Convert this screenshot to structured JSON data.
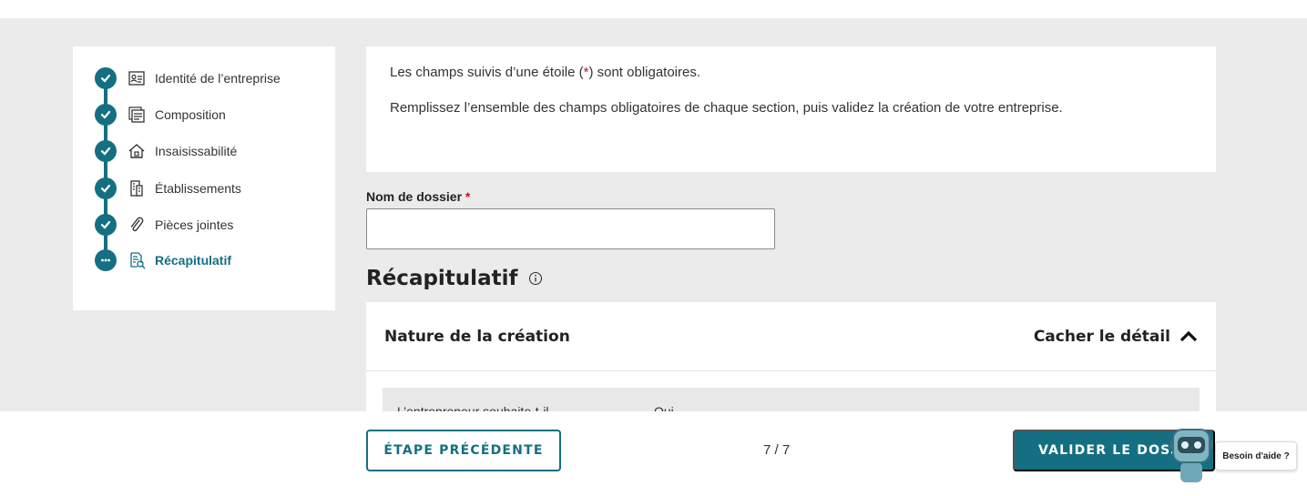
{
  "stepper": {
    "steps": [
      {
        "label": "Identité de l’entreprise",
        "state": "done",
        "icon": "id-card-icon"
      },
      {
        "label": "Composition",
        "state": "done",
        "icon": "documents-icon"
      },
      {
        "label": "Insaisissabilité",
        "state": "done",
        "icon": "house-icon"
      },
      {
        "label": "Établissements",
        "state": "done",
        "icon": "building-icon"
      },
      {
        "label": "Pièces jointes",
        "state": "done",
        "icon": "paperclip-icon"
      },
      {
        "label": "Récapitulatif",
        "state": "current",
        "icon": "document-search-icon"
      }
    ]
  },
  "info": {
    "line1_pre": "Les champs suivis d’une étoile (",
    "line1_star": "*",
    "line1_post": ") sont obligatoires.",
    "line2": "Remplissez l’ensemble des champs obligatoires de chaque section, puis validez la création de votre entreprise."
  },
  "form": {
    "dossier_label": "Nom de dossier",
    "required_mark": "*",
    "dossier_value": ""
  },
  "summary": {
    "title": "Récapitulatif",
    "panel_title": "Nature de la création",
    "toggle_label": "Cacher le détail",
    "row_key": "L’entrepreneur souhaite-t-il",
    "row_value": "Oui"
  },
  "footer": {
    "prev_label": "ÉTAPE PRÉCÉDENTE",
    "pager": "7 / 7",
    "validate_label": "VALIDER LE DOSSIER"
  },
  "help": {
    "label": "Besoin d'aide ?"
  },
  "colors": {
    "accent": "#156f82",
    "required": "#c8102e",
    "background": "#ebebeb"
  }
}
